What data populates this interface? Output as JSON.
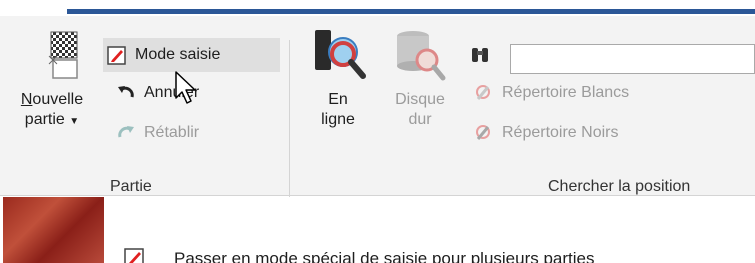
{
  "colors": {
    "accent": "#2b5797",
    "ribbon_bg": "#f3f3f3",
    "hover_bg": "#dfdfdf",
    "disabled": "#9b9b9b"
  },
  "ribbon": {
    "partie": {
      "new_game": {
        "line1_underlined": "N",
        "line1_rest": "ouvelle",
        "line2": "partie",
        "dropdown_icon": "caret-down-icon"
      },
      "mode_saisie": "Mode saisie",
      "annuler": "Annuler",
      "retablir": "Rétablir",
      "group_label": "Partie"
    },
    "chercher": {
      "en_ligne": {
        "line1": "En",
        "line2": "ligne"
      },
      "disque_dur": {
        "line1": "Disque",
        "line2": "dur"
      },
      "search_value": "",
      "repertoire_blancs": "Répertoire Blancs",
      "repertoire_noirs": "Répertoire Noirs",
      "group_label": "Chercher la position"
    }
  },
  "tooltip": {
    "text": "Passer en mode spécial de saisie pour plusieurs parties"
  }
}
